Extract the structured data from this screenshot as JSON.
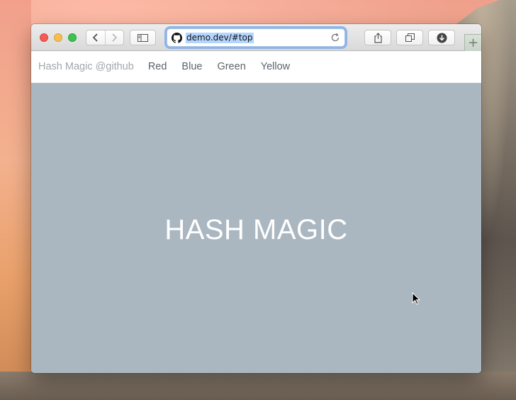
{
  "browser": {
    "address_bar": {
      "url": "demo.dev/#top",
      "site_icon": "github-icon"
    },
    "icons": {
      "back": "chevron-left-icon",
      "forward": "chevron-right-icon",
      "sidebar": "sidebar-icon",
      "reload": "reload-icon",
      "share": "share-icon",
      "tabs": "tabs-overview-icon",
      "download": "download-icon",
      "new_tab": "plus-icon"
    },
    "new_tab_label": "+"
  },
  "site_nav": {
    "brand": "Hash Magic @github",
    "links": [
      "Red",
      "Blue",
      "Green",
      "Yellow"
    ]
  },
  "hero": {
    "title": "HASH MAGIC",
    "background": "#aab7c1"
  }
}
